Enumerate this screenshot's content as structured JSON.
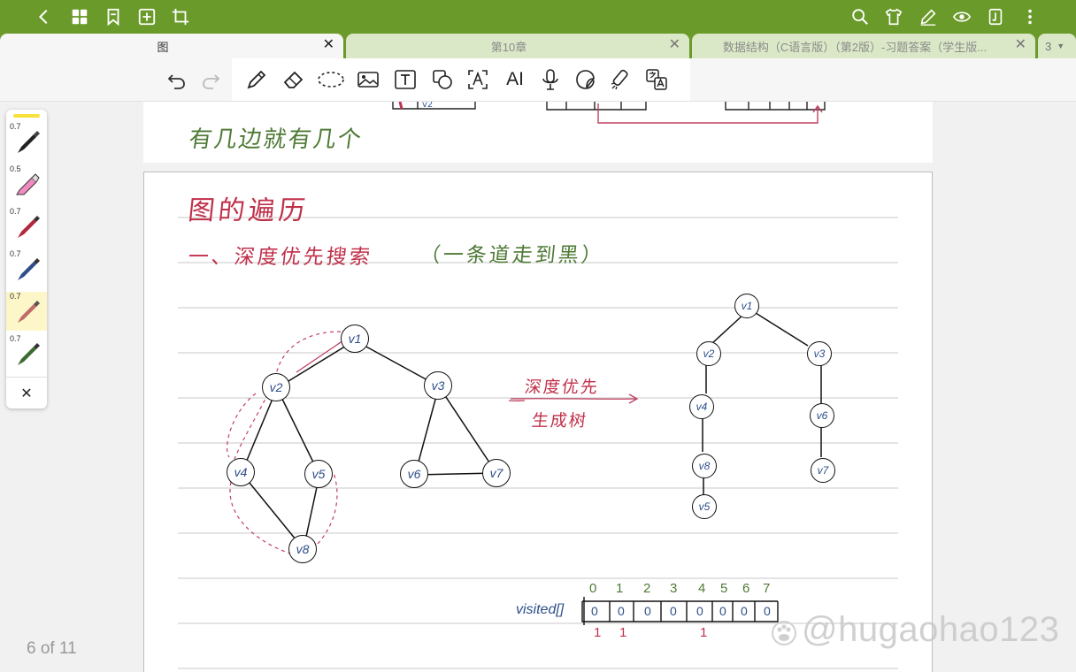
{
  "tabs": [
    {
      "label": "图",
      "active": true
    },
    {
      "label": "第10章",
      "active": false
    },
    {
      "label": "数据结构（C语言版）（第2版）-习题答案（学生版...",
      "active": false
    }
  ],
  "tab_overflow_count": "3",
  "tab_overflow_arrow": "▼",
  "close_glyph": "✕",
  "toolbar_ai_label": "AI",
  "pen_sizes": [
    "0.7",
    "0.5",
    "0.7",
    "0.7",
    "0.7",
    "0.7"
  ],
  "pen_colors": [
    "#222222",
    "#f08ac0",
    "#b3263b",
    "#2d4e8a",
    "#c06a6a",
    "#3a6b2f"
  ],
  "highlight_color": "#f7e23b",
  "accent_color": "#6a9a2a",
  "page_indicator": "6 of 11",
  "watermark": "@hugaohao123",
  "notes": {
    "prev_note": "有几边就有几个",
    "title": "图的遍历",
    "subtitle": "一、深度优先搜索",
    "subtitle_paren": "（一条道走到黑）",
    "arrow_label_1": "深度优先",
    "arrow_label_2": "生成树",
    "visited_label": "visited[]",
    "visited_indices": [
      "0",
      "1",
      "2",
      "3",
      "4",
      "5",
      "6",
      "7"
    ],
    "visited_values": [
      "0",
      "0",
      "0",
      "0",
      "0",
      "0",
      "0",
      "0"
    ],
    "visited_marks": [
      "1",
      "1",
      "1"
    ],
    "graph_nodes": [
      "v1",
      "v2",
      "v3",
      "v4",
      "v5",
      "v6",
      "v7",
      "v8"
    ],
    "tree_nodes": [
      "v1",
      "v2",
      "v3",
      "v4",
      "v6",
      "v8",
      "v7",
      "v5"
    ]
  }
}
